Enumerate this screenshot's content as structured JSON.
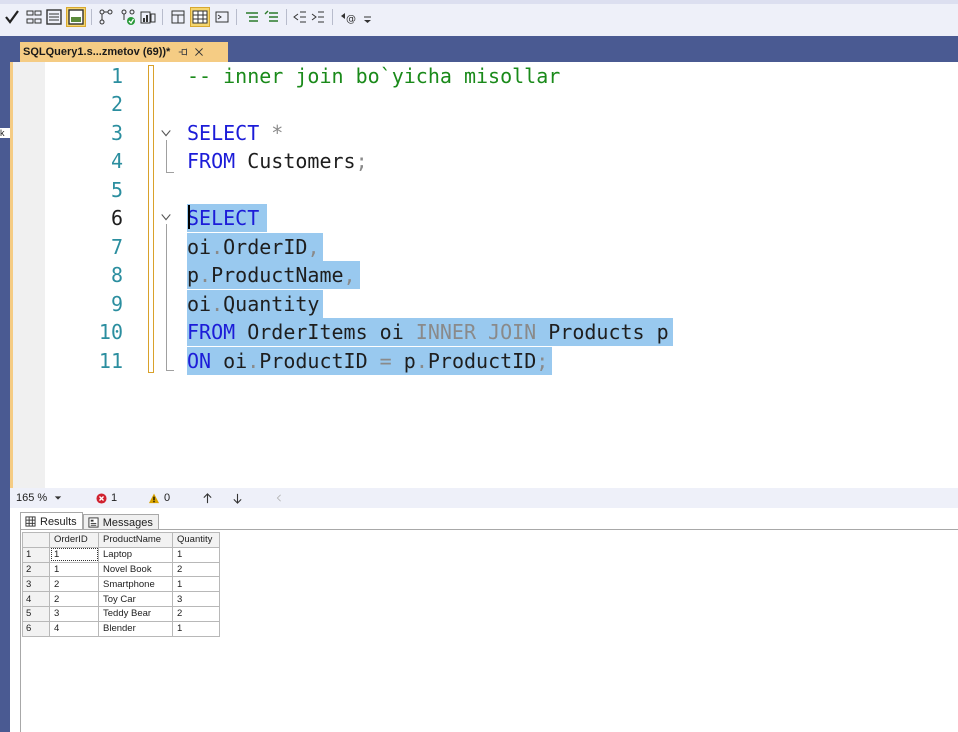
{
  "colors": {
    "rail": "#4a5a92",
    "tab_active": "#f5cc84",
    "selection": "#99c9ef",
    "keyword": "#1c1cd8",
    "comment": "#1a8a1a",
    "line_number": "#2b8e9f",
    "error": "#d0212f",
    "warning": "#d9a300"
  },
  "toolbar": {
    "icons": [
      "execute-check-icon",
      "parse-icon",
      "results-to-text-icon",
      "results-to-grid-icon",
      "include-plan-icon",
      "live-stats-icon",
      "client-stats-icon",
      "query-options-icon",
      "intellisense-icon",
      "sqlcmd-icon",
      "comment-icon",
      "uncomment-icon",
      "decrease-indent-icon",
      "increase-indent-icon",
      "specify-values-icon"
    ]
  },
  "doc_tab": {
    "title": "SQLQuery1.s...zmetov (69))*"
  },
  "editor": {
    "lines": [
      {
        "n": "1",
        "text": "-- inner join bo`yicha misollar"
      },
      {
        "n": "2"
      },
      {
        "n": "3",
        "kw": "SELECT",
        "rest": " *"
      },
      {
        "n": "4",
        "kw": "FROM",
        "rest": " Customers",
        "punct": ";"
      },
      {
        "n": "5"
      },
      {
        "n": "6",
        "kw": "SELECT"
      },
      {
        "n": "7",
        "a": "oi",
        "dot": ".",
        "b": "OrderID",
        "comma": ","
      },
      {
        "n": "8",
        "a": "p",
        "dot": ".",
        "b": "ProductName",
        "comma": ","
      },
      {
        "n": "9",
        "a": "oi",
        "dot": ".",
        "b": "Quantity"
      },
      {
        "n": "10",
        "kw": "FROM",
        "t1": " OrderItems oi ",
        "join": "INNER JOIN",
        "t2": " Products p"
      },
      {
        "n": "11",
        "kw": "ON",
        "a": " oi",
        "dot": ".",
        "b": "ProductID",
        "eq": " = ",
        "c": "p",
        "dot2": ".",
        "d": "ProductID",
        "semi": ";"
      }
    ]
  },
  "status": {
    "zoom": "165 %",
    "errors": "1",
    "warnings": "0"
  },
  "results": {
    "tabs": [
      {
        "label": "Results",
        "icon": "grid-icon"
      },
      {
        "label": "Messages",
        "icon": "messages-icon"
      }
    ],
    "columns": [
      "OrderID",
      "ProductName",
      "Quantity"
    ],
    "rows": [
      {
        "rn": "1",
        "OrderID": "1",
        "ProductName": "Laptop",
        "Quantity": "1"
      },
      {
        "rn": "2",
        "OrderID": "1",
        "ProductName": "Novel Book",
        "Quantity": "2"
      },
      {
        "rn": "3",
        "OrderID": "2",
        "ProductName": "Smartphone",
        "Quantity": "1"
      },
      {
        "rn": "4",
        "OrderID": "2",
        "ProductName": "Toy Car",
        "Quantity": "3"
      },
      {
        "rn": "5",
        "OrderID": "3",
        "ProductName": "Teddy Bear",
        "Quantity": "2"
      },
      {
        "rn": "6",
        "OrderID": "4",
        "ProductName": "Blender",
        "Quantity": "1"
      }
    ]
  }
}
